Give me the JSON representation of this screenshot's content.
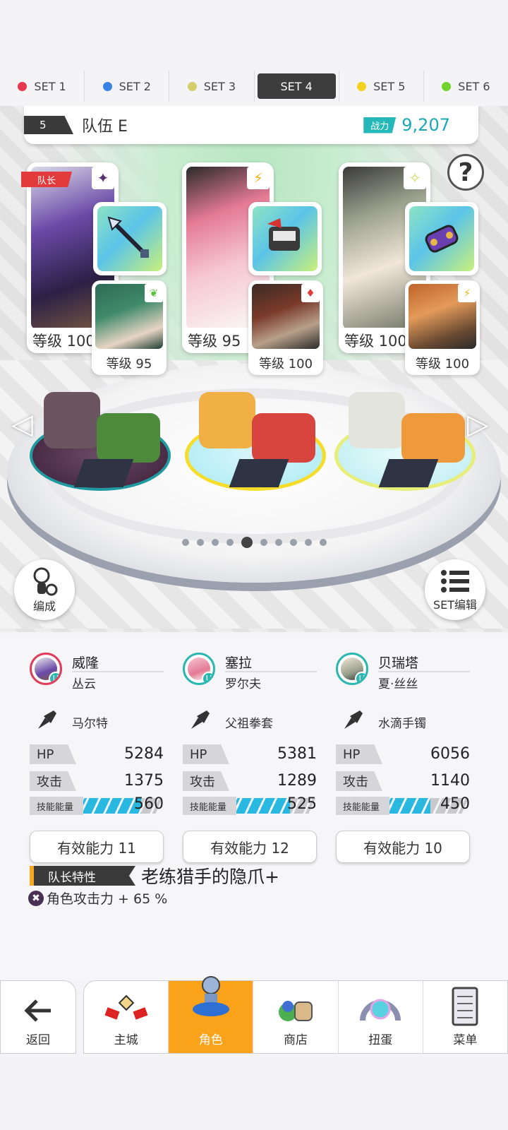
{
  "set_tabs": [
    {
      "label": "SET 1",
      "color": "#e8384f",
      "active": false
    },
    {
      "label": "SET 2",
      "color": "#3b82e6",
      "active": false
    },
    {
      "label": "SET 3",
      "color": "#d4cf6a",
      "active": false
    },
    {
      "label": "SET 4",
      "color": "#3d3d3d",
      "active": true
    },
    {
      "label": "SET 5",
      "color": "#f2d21f",
      "active": false
    },
    {
      "label": "SET 6",
      "color": "#72d32c",
      "active": false
    }
  ],
  "team": {
    "number": "5",
    "name": "队伍 E",
    "power_label": "战力",
    "power": "9,207"
  },
  "leader_tag": "队长",
  "help_icon": "?",
  "characters": [
    {
      "level": "等级 100",
      "element_icon": "dark",
      "sub_level": "等级 95",
      "sub_element_icon": "wind"
    },
    {
      "level": "等级 95",
      "element_icon": "lightning",
      "sub_level": "等级 100",
      "sub_element_icon": "fire"
    },
    {
      "level": "等级 100",
      "element_icon": "light",
      "sub_level": "等级 100",
      "sub_element_icon": "lightning"
    }
  ],
  "page_dots": {
    "count": 10,
    "active": 5
  },
  "buttons": {
    "formation": "编成",
    "set_edit": "SET编辑"
  },
  "details": [
    {
      "name": "威隆",
      "accessory": "丛云",
      "weapon": "马尔特",
      "hp_label": "HP",
      "hp": "5284",
      "atk_label": "攻击",
      "atk": "1375",
      "energy_label": "技能能量",
      "energy": "560",
      "energy_fill": 0.75,
      "effective": "有效能力 11",
      "avatar_color": "#e23c5b"
    },
    {
      "name": "塞拉",
      "accessory": "罗尔夫",
      "weapon": "父祖拳套",
      "hp_label": "HP",
      "hp": "5381",
      "atk_label": "攻击",
      "atk": "1289",
      "energy_label": "技能能量",
      "energy": "525",
      "energy_fill": 0.7,
      "effective": "有效能力 12",
      "avatar_color": "#2bb7b0"
    },
    {
      "name": "贝瑞塔",
      "accessory": "夏·丝丝",
      "weapon": "水滴手镯",
      "hp_label": "HP",
      "hp": "6056",
      "atk_label": "攻击",
      "atk": "1140",
      "energy_label": "技能能量",
      "energy": "450",
      "energy_fill": 0.55,
      "effective": "有效能力 10",
      "avatar_color": "#2bb7b0"
    }
  ],
  "leader_skill": {
    "label": "队长特性",
    "title": "老练猎手的隐爪+",
    "effect": "角色攻击力 + 65 %"
  },
  "nav": {
    "back": "返回",
    "items": [
      {
        "label": "主城",
        "icon": "castle-icon",
        "active": false
      },
      {
        "label": "角色",
        "icon": "character-icon",
        "active": true
      },
      {
        "label": "商店",
        "icon": "shop-icon",
        "active": false
      },
      {
        "label": "扭蛋",
        "icon": "gacha-icon",
        "active": false
      },
      {
        "label": "菜单",
        "icon": "menu-icon",
        "active": false
      }
    ]
  }
}
